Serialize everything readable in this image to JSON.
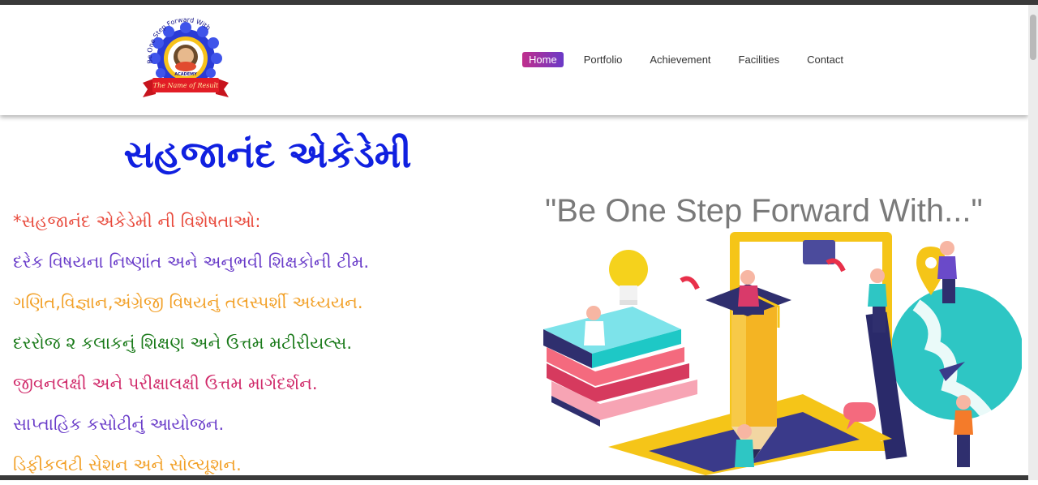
{
  "logo": {
    "arc_text": "Be One Step Forward With",
    "banner_top": "SAHAJANAND",
    "banner_bottom": "ACADEMY",
    "ribbon": "The Name of Result"
  },
  "nav": {
    "items": [
      {
        "label": "Home",
        "active": true
      },
      {
        "label": "Portfolio"
      },
      {
        "label": "Achievement"
      },
      {
        "label": "Facilities"
      },
      {
        "label": "Contact"
      }
    ]
  },
  "hero": {
    "title": "સહજાનંદ એકેડેમી",
    "features": [
      {
        "text": "*સહજાનંદ એકેડેમી ની વિશેષતાઓ:",
        "color": "#e8483a"
      },
      {
        "text": "દરેક વિષયના નિષ્ણાંત અને અનુભવી શિક્ષકોની ટીમ.",
        "color": "#6a3dc9"
      },
      {
        "text": "ગણિત,વિજ્ઞાન,અંગ્રેજી વિષયનું તલસ્પર્શી અધ્યયન.",
        "color": "#f2a027"
      },
      {
        "text": "દરરોજ ૨ કલાકનું શિક્ષણ અને ઉત્તમ મટીરીયલ્સ.",
        "color": "#1a7a1a"
      },
      {
        "text": "જીવનલક્ષી અને પરીક્ષાલક્ષી ઉત્તમ માર્ગદર્શન.",
        "color": "#d02a6a"
      },
      {
        "text": "સાપ્તાહિક કસોટીનું આયોજન.",
        "color": "#6a3dc9"
      },
      {
        "text": "ડિફીકલટી સેશન અને સોલ્યૂશન.",
        "color": "#f2a027"
      }
    ],
    "tagline": "\"Be One Step Forward With...\""
  },
  "colors": {
    "title_blue": "#1020e0",
    "nav_active_start": "#c02f8c",
    "nav_active_end": "#6a39c7",
    "tagline_gray": "#7a7a7a"
  },
  "icons": {
    "logo": "academy-logo",
    "illustration": "education-illustration"
  }
}
